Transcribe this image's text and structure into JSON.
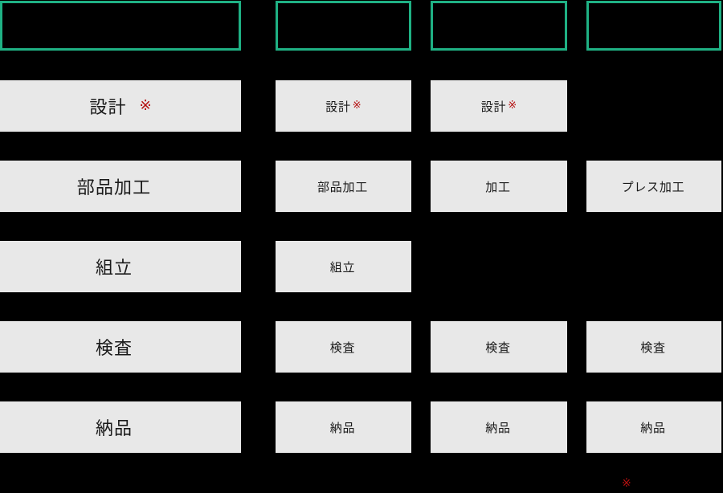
{
  "theme": {
    "background": "#000000",
    "box_fill": "#e8e8e8",
    "box_text": "#1a1a1a",
    "header_border": "#1fb184",
    "mark_color": "#b51010"
  },
  "columns": [
    {
      "id": "column-1",
      "header_label": ""
    },
    {
      "id": "column-2",
      "header_label": ""
    },
    {
      "id": "column-3",
      "header_label": ""
    },
    {
      "id": "column-4",
      "header_label": ""
    }
  ],
  "grid": {
    "rows": [
      {
        "row_id": "row-1",
        "cells": [
          {
            "label": "設計",
            "mark": "※",
            "present": true
          },
          {
            "label": "設計",
            "mark": "※",
            "present": true
          },
          {
            "label": "設計",
            "mark": "※",
            "present": true
          },
          {
            "label": "",
            "mark": "",
            "present": false
          }
        ]
      },
      {
        "row_id": "row-2",
        "cells": [
          {
            "label": "部品加工",
            "mark": "",
            "present": true
          },
          {
            "label": "部品加工",
            "mark": "",
            "present": true
          },
          {
            "label": "加工",
            "mark": "",
            "present": true
          },
          {
            "label": "プレス加工",
            "mark": "",
            "present": true
          }
        ]
      },
      {
        "row_id": "row-3",
        "cells": [
          {
            "label": "組立",
            "mark": "",
            "present": true
          },
          {
            "label": "組立",
            "mark": "",
            "present": true
          },
          {
            "label": "",
            "mark": "",
            "present": false
          },
          {
            "label": "",
            "mark": "",
            "present": false
          }
        ]
      },
      {
        "row_id": "row-4",
        "cells": [
          {
            "label": "検査",
            "mark": "",
            "present": true
          },
          {
            "label": "検査",
            "mark": "",
            "present": true
          },
          {
            "label": "検査",
            "mark": "",
            "present": true
          },
          {
            "label": "検査",
            "mark": "",
            "present": true
          }
        ]
      },
      {
        "row_id": "row-5",
        "cells": [
          {
            "label": "納品",
            "mark": "",
            "present": true
          },
          {
            "label": "納品",
            "mark": "",
            "present": true
          },
          {
            "label": "納品",
            "mark": "",
            "present": true
          },
          {
            "label": "納品",
            "mark": "",
            "present": true
          }
        ]
      }
    ]
  },
  "footnote": {
    "mark": "※"
  }
}
